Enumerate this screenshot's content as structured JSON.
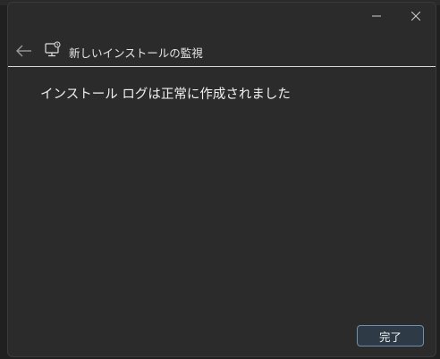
{
  "window": {
    "controls": {
      "minimize_icon": "minimize-icon",
      "close_icon": "close-icon"
    }
  },
  "header": {
    "back_icon": "back-arrow-icon",
    "app_icon": "monitor-icon",
    "title": "新しいインストールの監視"
  },
  "content": {
    "message": "インストール ログは正常に作成されました"
  },
  "footer": {
    "done_label": "完了"
  },
  "colors": {
    "window_bg": "#2b2b2b",
    "text": "#f0f0f0",
    "accent_border": "#6e8fad"
  }
}
